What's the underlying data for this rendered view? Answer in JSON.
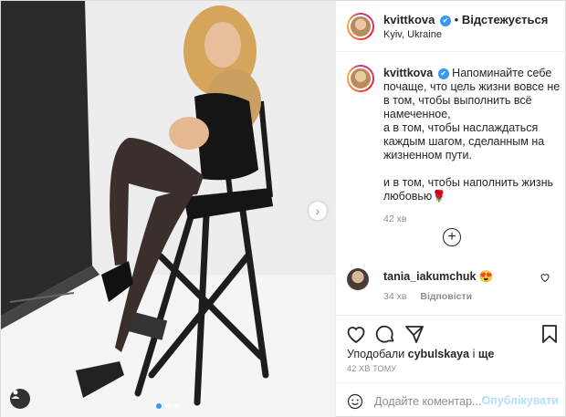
{
  "post": {
    "author": "kvittkova",
    "verified_mark": "✔",
    "separator": "•",
    "follow_status": "Відстежується",
    "location": "Kyiv, Ukraine"
  },
  "caption": {
    "author": "kvittkova",
    "lines": [
      "Напоминайте себе почаще, что цель жизни вовсе не в том, чтобы выполнить всё намеченное,",
      "а в том, чтобы наслаждаться каждым шагом, сделанным на жизненном пути.",
      "",
      "и в том, чтобы наполнить жизнь любовью🌹"
    ],
    "time": "42 хв"
  },
  "expand_comments_icon": "plus-circle-icon",
  "comment": {
    "author": "tania_iakumchuk",
    "emoji": "😍",
    "time": "34 хв",
    "reply_label": "Відповісти"
  },
  "actions": {
    "like_icon": "heart-icon",
    "comment_icon": "speech-bubble-icon",
    "share_icon": "paper-plane-icon",
    "save_icon": "bookmark-icon"
  },
  "likes": {
    "prefix": "Уподобали",
    "user": "cybulskaya",
    "suffix": "і",
    "more": "ще"
  },
  "post_time": "42 ХВ ТОМУ",
  "add_comment": {
    "placeholder": "Додайте коментар...",
    "publish_label": "Опублікувати"
  },
  "carousel": {
    "dots": 3,
    "active_dot": 1
  },
  "colors": {
    "verified": "#3897f0",
    "publish_disabled": "#b2dffc",
    "secondary_text": "#8e8e8e"
  }
}
